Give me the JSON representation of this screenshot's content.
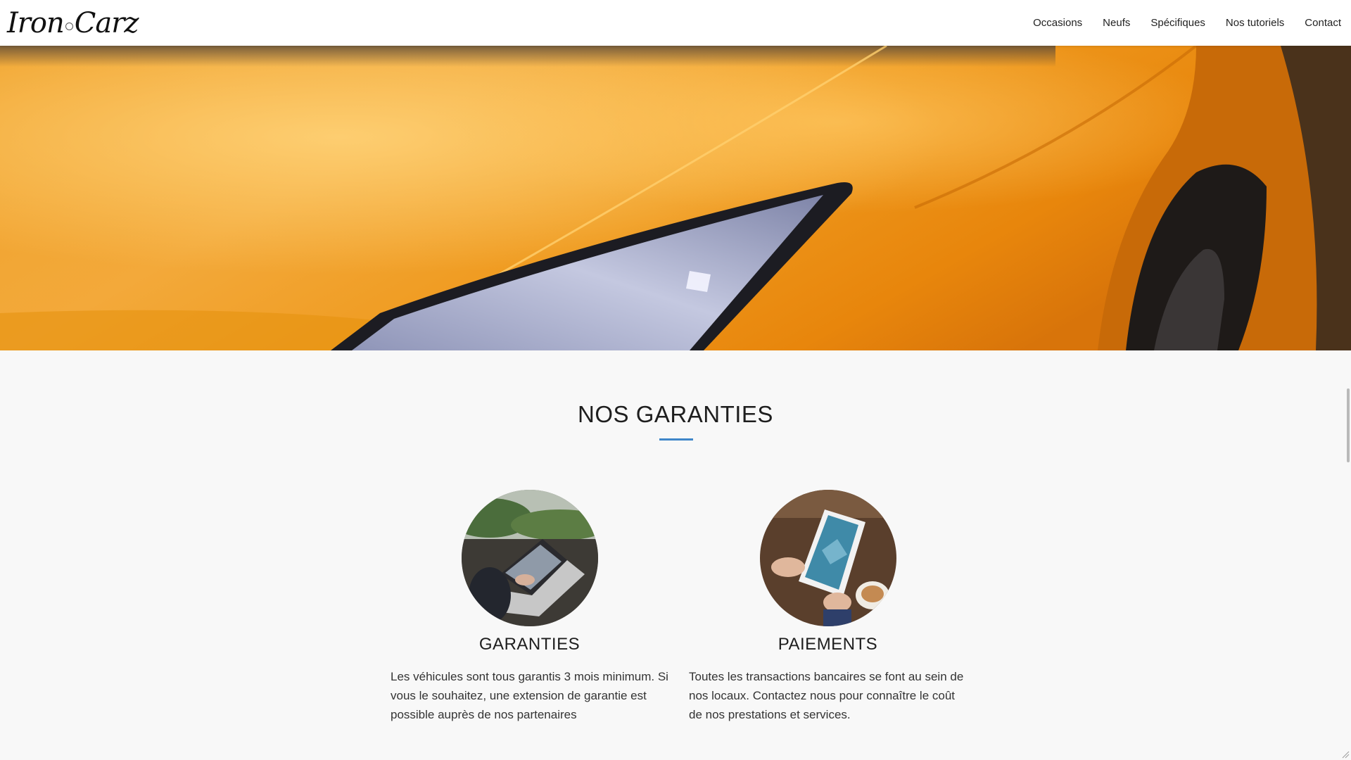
{
  "header": {
    "logo_left": "Iron",
    "logo_right": "Carz",
    "nav": [
      {
        "label": "Occasions"
      },
      {
        "label": "Neufs"
      },
      {
        "label": "Spécifiques"
      },
      {
        "label": "Nos tutoriels"
      },
      {
        "label": "Contact"
      }
    ]
  },
  "hero": {
    "image": "orange-sports-car-headlight",
    "colors": {
      "paint": "#e8900f",
      "light": "#ffc862",
      "headlight": "#b9bfd8"
    }
  },
  "section": {
    "title": "NOS GARANTIES",
    "accent_color": "#3f86c9",
    "features": [
      {
        "icon": "laptop-photo",
        "title": "GARANTIES",
        "text": "Les véhicules sont tous garantis 3 mois minimum. Si vous le souhaitez, une extension de garantie est possible auprès de nos partenaires"
      },
      {
        "icon": "tablet-photo",
        "title": "PAIEMENTS",
        "text": "Toutes les transactions bancaires se font au sein de nos locaux. Contactez nous pour connaître le coût de nos prestations et services."
      }
    ]
  }
}
